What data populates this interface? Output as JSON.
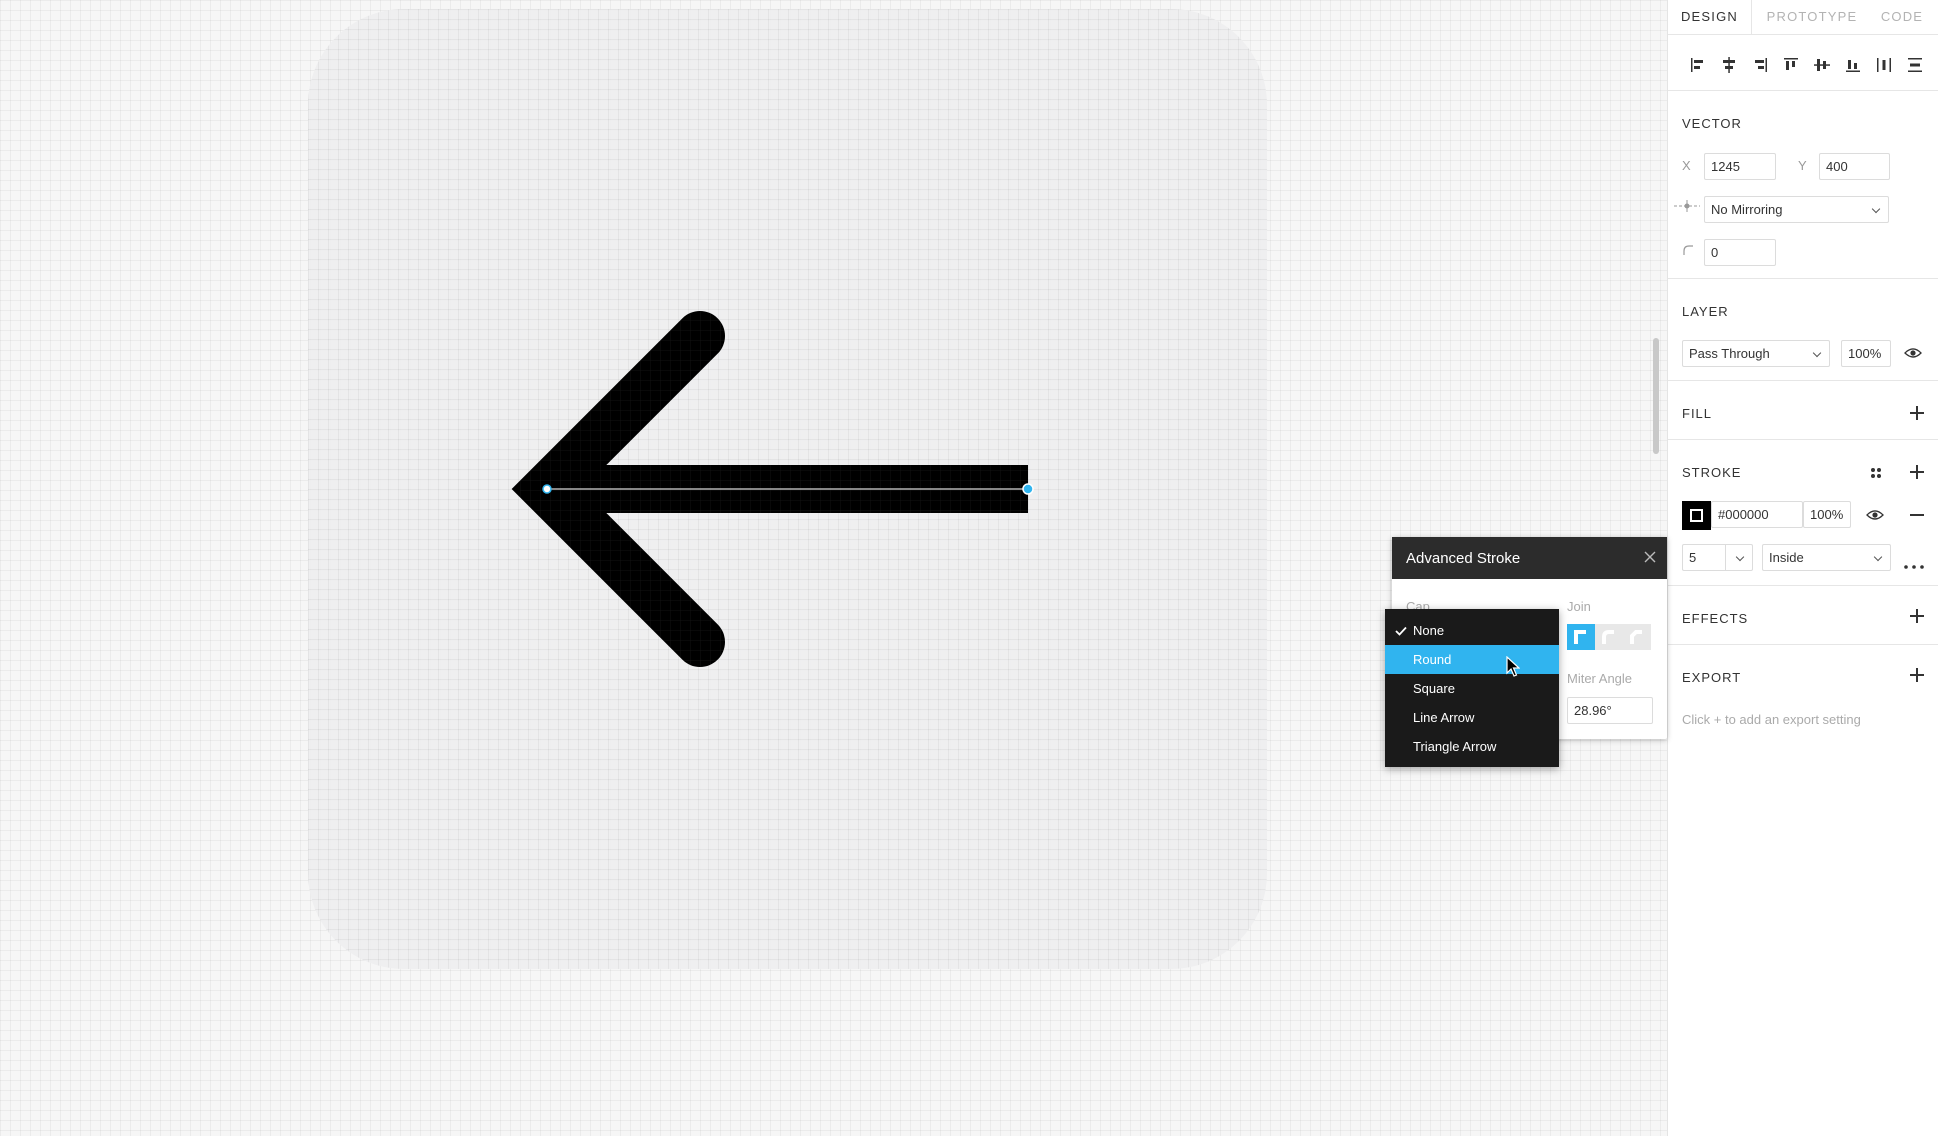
{
  "tabs": [
    {
      "label": "DESIGN",
      "active": true
    },
    {
      "label": "PROTOTYPE",
      "active": false
    },
    {
      "label": "CODE",
      "active": false
    }
  ],
  "align_icons": [
    "align-left-icon",
    "align-horizontal-center-icon",
    "align-right-icon",
    "align-top-icon",
    "align-vertical-center-icon",
    "align-bottom-icon",
    "distribute-horizontal-icon",
    "distribute-vertical-icon"
  ],
  "vector": {
    "title": "VECTOR",
    "x_label": "X",
    "x_value": "1245",
    "y_label": "Y",
    "y_value": "400",
    "mirroring": "No Mirroring",
    "corner_radius": "0"
  },
  "layer": {
    "title": "LAYER",
    "blend_mode": "Pass Through",
    "opacity": "100%"
  },
  "fill": {
    "title": "FILL"
  },
  "stroke": {
    "title": "STROKE",
    "color_hex": "#000000",
    "opacity": "100%",
    "weight": "5",
    "position": "Inside"
  },
  "effects": {
    "title": "EFFECTS"
  },
  "export": {
    "title": "EXPORT",
    "hint": "Click + to add an export setting"
  },
  "advanced_stroke": {
    "title": "Advanced Stroke",
    "cap_label": "Cap",
    "join_label": "Join",
    "miter_label": "Miter Angle",
    "miter_value": "28.96°"
  },
  "cap_options": [
    {
      "label": "None",
      "checked": true,
      "highlighted": false
    },
    {
      "label": "Round",
      "checked": false,
      "highlighted": true
    },
    {
      "label": "Square",
      "checked": false,
      "highlighted": false
    },
    {
      "label": "Line Arrow",
      "checked": false,
      "highlighted": false
    },
    {
      "label": "Triangle Arrow",
      "checked": false,
      "highlighted": false
    }
  ],
  "colors": {
    "accent": "#30b4ef",
    "stroke_color": "#000000",
    "frame_fill": "#eeeef0"
  }
}
